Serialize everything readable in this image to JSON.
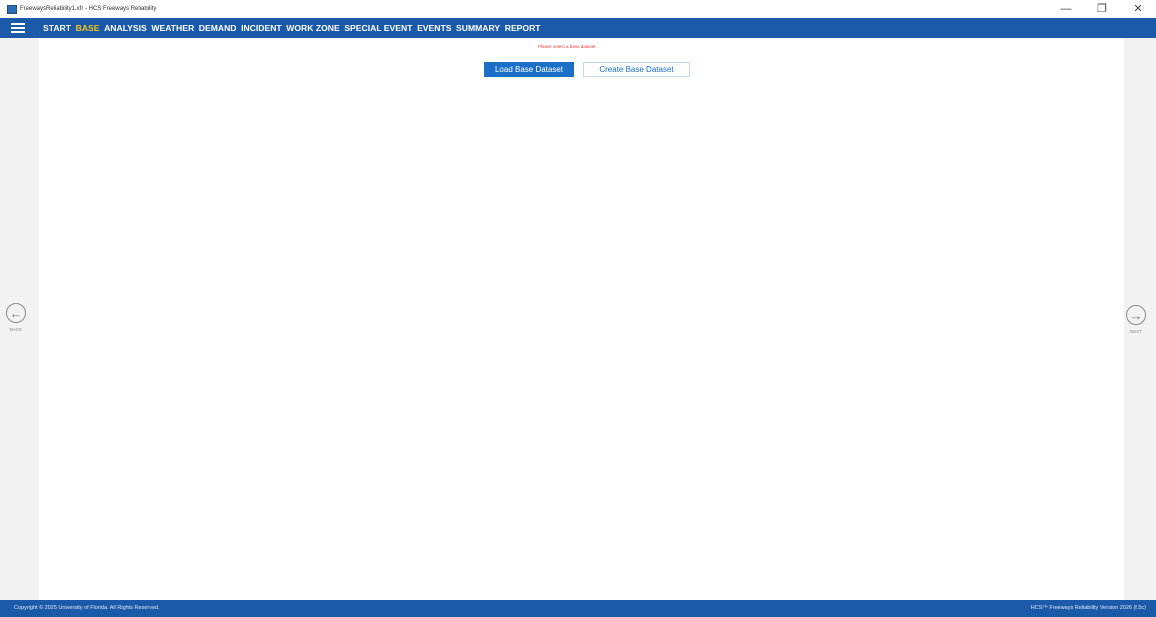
{
  "window": {
    "title": "FreewaysReliability1.xfr - HCS Freeways Reliability",
    "minimize_glyph": "—",
    "restore_glyph": "❐",
    "close_glyph": "✕"
  },
  "menu": {
    "items": [
      "START",
      "BASE",
      "ANALYSIS",
      "WEATHER",
      "DEMAND",
      "INCIDENT",
      "WORK ZONE",
      "SPECIAL EVENT",
      "EVENTS",
      "SUMMARY",
      "REPORT"
    ],
    "active": "BASE"
  },
  "main": {
    "warning": "Please select a base dataset",
    "load_button": "Load Base Dataset",
    "create_button": "Create Base Dataset"
  },
  "nav": {
    "back_glyph": "←",
    "back_label": "BACK",
    "next_glyph": "→",
    "next_label": "NEXT"
  },
  "footer": {
    "copyright": "Copyright © 2025 University of Florida. All Rights Reserved.",
    "version": "HCS™ Freeways Reliability Version 2026 (f.5c)"
  },
  "colors": {
    "brand_blue": "#1b5aa8",
    "active_menu": "#f5c518",
    "warning_red": "#e03c3c",
    "primary_button": "#1b6fc7"
  },
  "icons": {
    "app": "app-icon",
    "menu": "hamburger-icon",
    "back": "arrow-left-circle-icon",
    "next": "arrow-right-circle-icon"
  }
}
